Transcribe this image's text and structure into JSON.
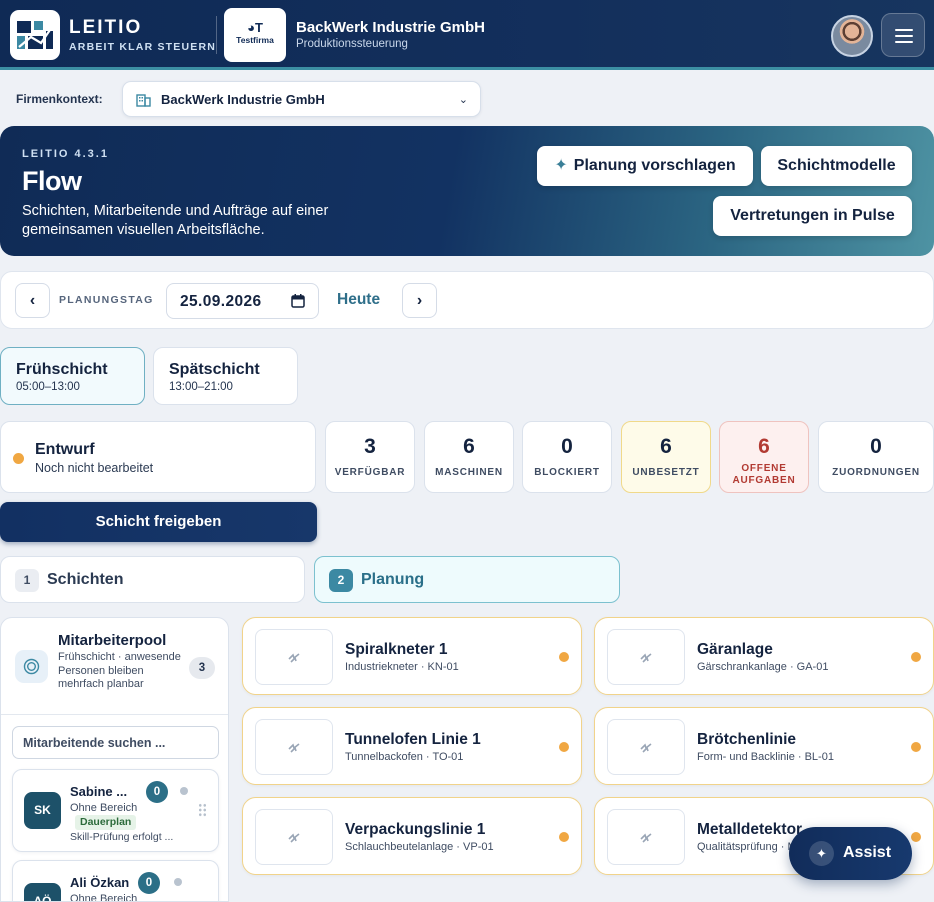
{
  "header": {
    "brand_name": "LEITIO",
    "brand_tagline": "ARBEIT KLAR STEUERN",
    "tenant_logo_mark": "◕T",
    "tenant_logo_label": "Testfirma",
    "company_name": "BackWerk Industrie GmbH",
    "company_sub": "Produktionssteuerung",
    "icons": [
      "leitio-logo-icon",
      "user-avatar",
      "hamburger-menu-icon"
    ]
  },
  "context": {
    "label": "Firmenkontext:",
    "selected": "BackWerk Industrie GmbH",
    "icon": "building-icon"
  },
  "hero": {
    "version": "LEITIO 4.3.1",
    "title": "Flow",
    "description": "Schichten, Mitarbeitende und Aufträge auf einer gemeinsamen visuellen Arbeitsfläche.",
    "btn_suggest": "Planung vorschlagen",
    "btn_suggest_icon": "✦",
    "btn_models": "Schichtmodelle",
    "btn_pulse": "Vertretungen in Pulse"
  },
  "datebar": {
    "prev": "‹",
    "next": "›",
    "label": "PLANUNGSTAG",
    "date": "25.09.2026",
    "today": "Heute"
  },
  "shifts": [
    {
      "name": "Frühschicht",
      "time": "05:00–13:00",
      "active": true
    },
    {
      "name": "Spätschicht",
      "time": "13:00–21:00",
      "active": false
    }
  ],
  "status": {
    "title": "Entwurf",
    "subtitle": "Noch nicht bearbeitet",
    "color": "#f0a742"
  },
  "stats": [
    {
      "value": "3",
      "label": "VERFÜGBAR",
      "variant": "default"
    },
    {
      "value": "6",
      "label": "MASCHINEN",
      "variant": "default"
    },
    {
      "value": "0",
      "label": "BLOCKIERT",
      "variant": "default"
    },
    {
      "value": "6",
      "label": "UNBESETZT",
      "variant": "warn"
    },
    {
      "value": "6",
      "label": "OFFENE AUFGABEN",
      "variant": "danger"
    },
    {
      "value": "0",
      "label": "ZUORDNUNGEN",
      "variant": "default"
    }
  ],
  "release_button": "Schicht freigeben",
  "steps": [
    {
      "num": "1",
      "label": "Schichten",
      "active": false
    },
    {
      "num": "2",
      "label": "Planung",
      "active": true
    }
  ],
  "pool": {
    "title": "Mitarbeiterpool",
    "description": "Frühschicht · anwesende Personen bleiben mehrfach planbar",
    "count": "3",
    "search_placeholder": "Mitarbeitende suchen ...",
    "people": [
      {
        "initials": "SK",
        "name": "Sabine ...",
        "badge": "0",
        "area": "Ohne Bereich",
        "tag": "Dauerplan",
        "skill": "Skill-Prüfung erfolgt ..."
      },
      {
        "initials": "AÖ",
        "name": "Ali Özkan",
        "badge": "0",
        "area": "Ohne Bereich",
        "tag": "",
        "skill": ""
      }
    ]
  },
  "machines": [
    {
      "name": "Spiralkneter 1",
      "sub": "Industriekneter · KN-01"
    },
    {
      "name": "Gäranlage",
      "sub": "Gärschrankanlage · GA-01"
    },
    {
      "name": "Tunnelofen Linie 1",
      "sub": "Tunnelbackofen · TO-01"
    },
    {
      "name": "Brötchenlinie",
      "sub": "Form- und Backlinie · BL-01"
    },
    {
      "name": "Verpackungslinie 1",
      "sub": "Schlauchbeutelanlage · VP-01"
    },
    {
      "name": "Metalldetektor",
      "sub": "Qualitätsprüfung · MD-01"
    }
  ],
  "assist": {
    "label": "Assist",
    "icon": "✦"
  },
  "colors": {
    "brand": "#0f2a55",
    "accent": "#3c89a3",
    "warning": "#f0a742",
    "danger": "#b23a32"
  }
}
